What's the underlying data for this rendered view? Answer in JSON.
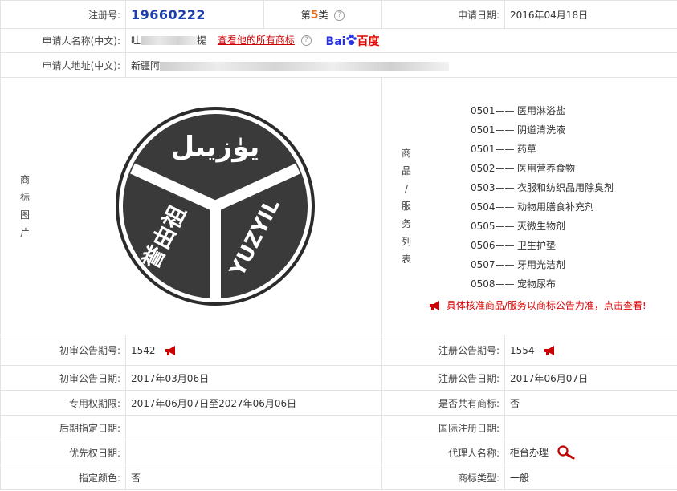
{
  "row1": {
    "reg_label": "注册号:",
    "reg_value": "19660222",
    "class_prefix": "第",
    "class_num": "5",
    "class_suffix": "类",
    "apply_date_label": "申请日期:",
    "apply_date_value": "2016年04月18日"
  },
  "applicant": {
    "name_label": "申请人名称(中文):",
    "name_visible_start": "吐",
    "name_visible_end": "提",
    "all_marks_link": "查看他的所有商标",
    "baidu_bai": "Bai",
    "baidu_du": "百度",
    "addr_label": "申请人地址(中文):",
    "addr_visible": "新疆阿"
  },
  "image_section": {
    "vertical_label": [
      "商",
      "标",
      "图",
      "片"
    ],
    "logo_arabic_text": "يۈزيىل",
    "logo_cn_text": "誉由祖",
    "logo_en_text": "YUZYIL"
  },
  "goods_section": {
    "vertical_label": [
      "商",
      "品",
      "/",
      "服",
      "务",
      "列",
      "表"
    ],
    "items": [
      {
        "code": "0501——",
        "name": "医用淋浴盐"
      },
      {
        "code": "0501——",
        "name": "阴道清洗液"
      },
      {
        "code": "0501——",
        "name": "药草"
      },
      {
        "code": "0502——",
        "name": "医用营养食物"
      },
      {
        "code": "0503——",
        "name": "衣服和纺织品用除臭剂"
      },
      {
        "code": "0504——",
        "name": "动物用膳食补充剂"
      },
      {
        "code": "0505——",
        "name": "灭微生物剂"
      },
      {
        "code": "0506——",
        "name": "卫生护垫"
      },
      {
        "code": "0507——",
        "name": "牙用光洁剂"
      },
      {
        "code": "0508——",
        "name": "宠物尿布"
      }
    ],
    "notice": "具体核准商品/服务以商标公告为准，点击查看!"
  },
  "details": {
    "prelim_no_label": "初审公告期号:",
    "prelim_no_value": "1542",
    "reg_pub_no_label": "注册公告期号:",
    "reg_pub_no_value": "1554",
    "prelim_date_label": "初审公告日期:",
    "prelim_date_value": "2017年03月06日",
    "reg_pub_date_label": "注册公告日期:",
    "reg_pub_date_value": "2017年06月07日",
    "exclusive_label": "专用权期限:",
    "exclusive_value": "2017年06月07日至2027年06月06日",
    "shared_label": "是否共有商标:",
    "shared_value": "否",
    "later_label": "后期指定日期:",
    "later_value": "",
    "intl_label": "国际注册日期:",
    "intl_value": "",
    "priority_label": "优先权日期:",
    "priority_value": "",
    "agent_label": "代理人名称:",
    "agent_value": "柜台办理",
    "color_label": "指定颜色:",
    "color_value": "否",
    "type_label": "商标类型:",
    "type_value": "一般"
  },
  "colors": {
    "reg_blue": "#1c3ea8",
    "class_orange": "#e36a1b",
    "notice_red": "#d00000",
    "border": "#e3e3e3"
  },
  "icons": [
    "question-icon",
    "baidu-paw-icon",
    "megaphone-icon",
    "magnifier-icon"
  ]
}
